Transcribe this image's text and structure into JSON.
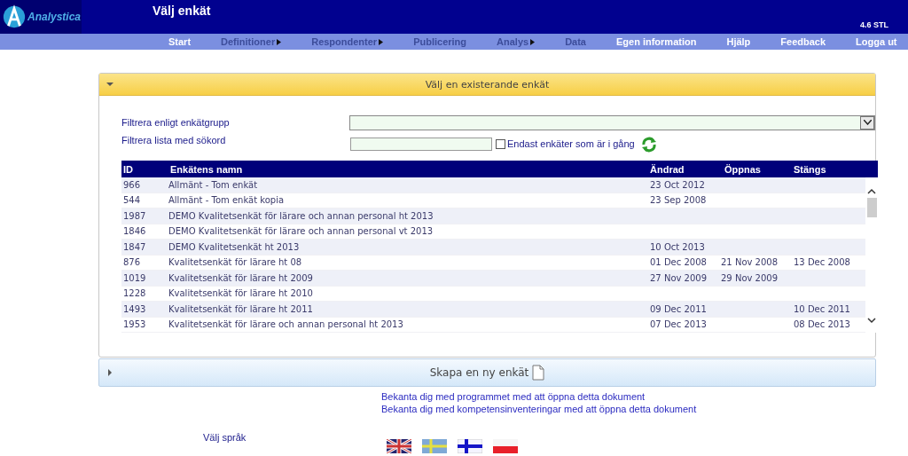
{
  "header": {
    "logo": "Analystica",
    "title": "Välj enkät",
    "version": "4.6 STL"
  },
  "menu": [
    {
      "label": "Start",
      "disabled": false,
      "submenu": false
    },
    {
      "label": "Definitioner",
      "disabled": true,
      "submenu": true
    },
    {
      "label": "Respondenter",
      "disabled": true,
      "submenu": true
    },
    {
      "label": "Publicering",
      "disabled": true,
      "submenu": false
    },
    {
      "label": "Analys",
      "disabled": true,
      "submenu": true
    },
    {
      "label": "Data",
      "disabled": true,
      "submenu": false
    },
    {
      "label": "Egen information",
      "disabled": false,
      "submenu": false
    },
    {
      "label": "Hjälp",
      "disabled": false,
      "submenu": false
    },
    {
      "label": "Feedback",
      "disabled": false,
      "submenu": false
    },
    {
      "label": "Logga ut",
      "disabled": false,
      "submenu": false
    }
  ],
  "select_panel": {
    "title": "Välj en existerande enkät",
    "expanded": true,
    "group_filter_label": "Filtrera enligt enkätgrupp",
    "search_label": "Filtrera lista med sökord",
    "running_only": {
      "label": "Endast enkäter som är i gång",
      "checked": false
    },
    "table": {
      "columns": [
        "ID",
        "Enkätens namn",
        "Ändrad",
        "Öppnas",
        "Stängs"
      ],
      "rows": [
        [
          "966",
          "Allmänt - Tom enkät",
          "23 Oct 2012",
          "",
          ""
        ],
        [
          "544",
          "Allmänt - Tom enkät kopia",
          "23 Sep 2008",
          "",
          ""
        ],
        [
          "1987",
          "DEMO Kvalitetsenkät för lärare och annan personal ht 2013",
          "",
          "",
          ""
        ],
        [
          "1846",
          "DEMO Kvalitetsenkät för lärare och annan personal vt 2013",
          "",
          "",
          ""
        ],
        [
          "1847",
          "DEMO Kvalitetsenkät ht 2013",
          "10 Oct 2013",
          "",
          ""
        ],
        [
          "876",
          "Kvalitetsenkät för lärare ht 08",
          "01 Dec 2008",
          "21 Nov 2008",
          "13 Dec 2008"
        ],
        [
          "1019",
          "Kvalitetsenkät för lärare ht 2009",
          "27 Nov 2009",
          "29 Nov 2009",
          ""
        ],
        [
          "1228",
          "Kvalitetsenkät för lärare ht 2010",
          "",
          "",
          ""
        ],
        [
          "1493",
          "Kvalitetsenkät för lärare ht 2011",
          "09 Dec 2011",
          "",
          "10 Dec 2011"
        ],
        [
          "1953",
          "Kvalitetsenkät för lärare och annan personal ht 2013",
          "07 Dec 2013",
          "",
          "08 Dec 2013"
        ]
      ]
    }
  },
  "create_panel": {
    "title": "Skapa en ny enkät",
    "expanded": false
  },
  "links": [
    "Bekanta dig med programmet med att öppna detta dokument",
    "Bekanta dig med kompetensinventeringar med att öppna detta dokument"
  ],
  "language_label": "Välj språk"
}
